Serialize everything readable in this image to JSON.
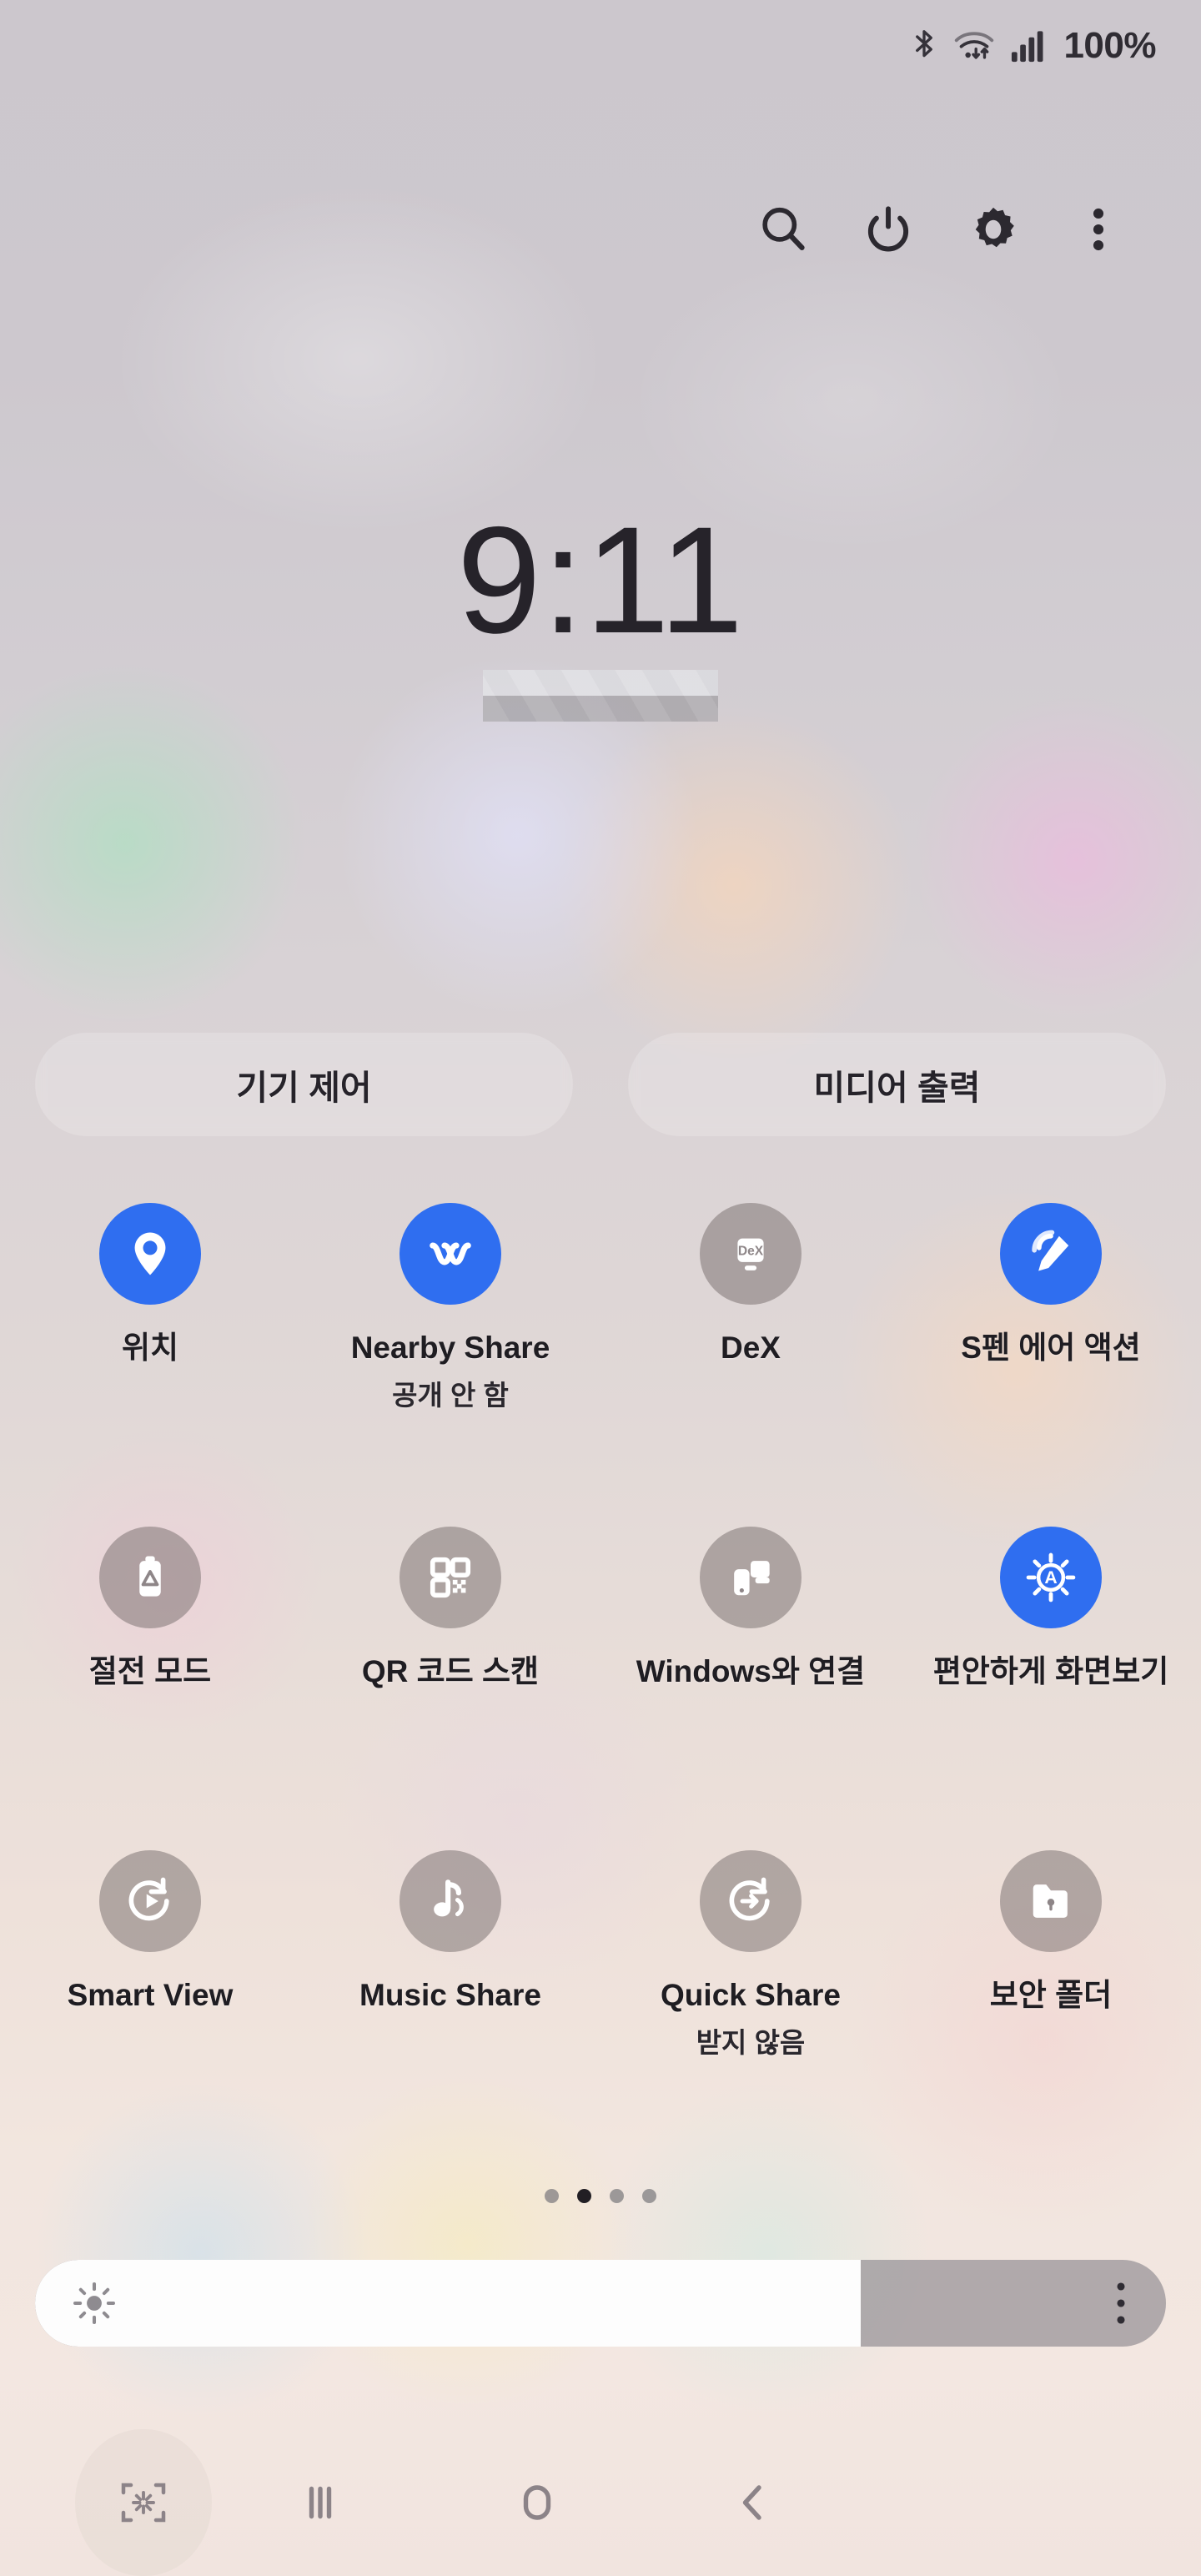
{
  "status_bar": {
    "icons": [
      "bluetooth-icon",
      "wifi-icon",
      "signal-icon"
    ],
    "battery": "100%"
  },
  "toolbar": {
    "buttons": [
      {
        "name": "search-button",
        "icon": "search-icon"
      },
      {
        "name": "power-button",
        "icon": "power-icon"
      },
      {
        "name": "settings-button",
        "icon": "gear-icon"
      },
      {
        "name": "more-button",
        "icon": "three-dot-menu-icon"
      }
    ]
  },
  "clock": {
    "time": "9:11"
  },
  "pills": [
    {
      "label": "기기 제어"
    },
    {
      "label": "미디어 출력"
    }
  ],
  "toggles": [
    [
      {
        "label": "위치",
        "sub": "",
        "state": "on",
        "icon": "location-pin-icon"
      },
      {
        "label": "Nearby Share",
        "sub": "공개 안 함",
        "state": "on",
        "icon": "nearby-share-icon"
      },
      {
        "label": "DeX",
        "sub": "",
        "state": "off",
        "icon": "dex-icon"
      },
      {
        "label": "S펜 에어 액션",
        "sub": "",
        "state": "on",
        "icon": "spen-air-action-icon"
      }
    ],
    [
      {
        "label": "절전 모드",
        "sub": "",
        "state": "off",
        "icon": "power-saving-icon"
      },
      {
        "label": "QR 코드 스캔",
        "sub": "",
        "state": "off",
        "icon": "qr-code-icon"
      },
      {
        "label": "Windows와 연결",
        "sub": "",
        "state": "off",
        "icon": "link-to-windows-icon"
      },
      {
        "label": "편안하게 화면보기",
        "sub": "",
        "state": "on",
        "icon": "eye-comfort-shield-icon"
      }
    ],
    [
      {
        "label": "Smart View",
        "sub": "",
        "state": "off",
        "icon": "smart-view-icon"
      },
      {
        "label": "Music Share",
        "sub": "",
        "state": "off",
        "icon": "music-share-icon"
      },
      {
        "label": "Quick Share",
        "sub": "받지 않음",
        "state": "off",
        "icon": "quick-share-icon"
      },
      {
        "label": "보안 폴더",
        "sub": "",
        "state": "off",
        "icon": "secure-folder-icon"
      }
    ]
  ],
  "page_dots": {
    "count": 4,
    "active_index": 1
  },
  "brightness": {
    "level_percent": 73,
    "sun_icon": "brightness-sun-icon",
    "menu_icon": "three-dot-menu-icon"
  },
  "nav_bar": [
    {
      "name": "nav-capture-button",
      "icon": "screen-capture-icon"
    },
    {
      "name": "nav-recents-button",
      "icon": "recents-icon"
    },
    {
      "name": "nav-home-button",
      "icon": "home-icon"
    },
    {
      "name": "nav-back-button",
      "icon": "back-chevron-icon"
    }
  ],
  "colors": {
    "accent_blue": "#2f6ef0",
    "toggle_off": "#7a7070",
    "text_dark": "#1f1d22"
  }
}
